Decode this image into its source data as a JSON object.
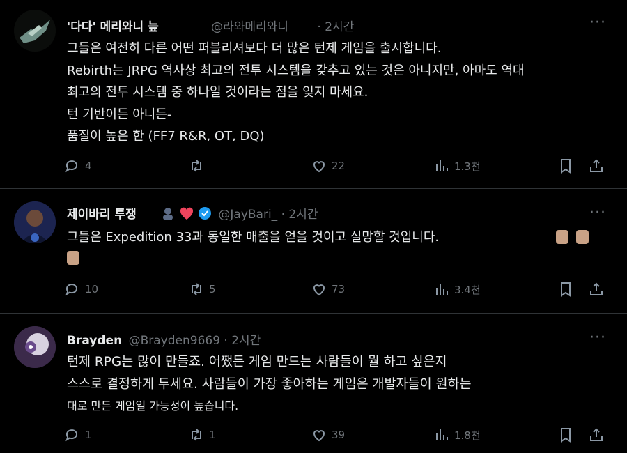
{
  "tweets": [
    {
      "name": "'다다' 메리와니 늪",
      "handle": "@라와메리와니",
      "time": "· 2시간",
      "lines": [
        "그들은 여전히 다른 어떤 퍼블리셔보다 더 많은 턴제 게임을 출시합니다.",
        "Rebirth는 JRPG 역사상 최고의 전투 시스템을 갖추고 있는 것은 아니지만, 아마도 역대",
        "최고의 전투 시스템 중 하나일 것이라는 점을 잊지 마세요.",
        "턴 기반이든 아니든-",
        "품질이 높은 한 (FF7 R&R, OT, DQ)"
      ],
      "replies": "4",
      "retweets": "",
      "likes": "22",
      "views": "1.3천"
    },
    {
      "name": "제이바리 투쟁",
      "handle": "@JayBari_",
      "time": "· 2시간",
      "lines": [
        "그들은 Expedition 33과 동일한 매출을 얻을 것이고 실망할 것입니다."
      ],
      "replies": "10",
      "retweets": "5",
      "likes": "73",
      "views": "3.4천"
    },
    {
      "name": "Brayden",
      "handle": "@Brayden9669",
      "time": "· 2시간",
      "lines": [
        "턴제 RPG는 많이 만들죠. 어쨌든 게임 만드는 사람들이 뭘 하고 싶은지",
        "스스로 결정하게 두세요. 사람들이 가장 좋아하는 게임은 개발자들이 원하는",
        "대로 만든 게임일 가능성이 높습니다."
      ],
      "replies": "1",
      "retweets": "1",
      "likes": "39",
      "views": "1.8천"
    }
  ],
  "more_label": "···",
  "icons": [
    "more-icon",
    "reply-icon",
    "retweet-icon",
    "like-icon",
    "views-icon",
    "bookmark-icon",
    "share-icon",
    "verified-badge-icon",
    "heart-emoji-icon"
  ],
  "colors": {
    "background": "#000000",
    "text": "#e7e9ea",
    "muted": "#71767b",
    "verified": "#1d9bf0",
    "heart": "#f0445d"
  }
}
